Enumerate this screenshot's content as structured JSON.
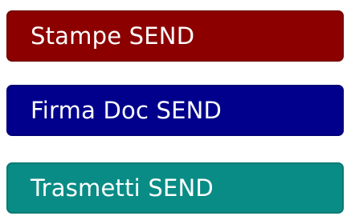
{
  "buttons": [
    {
      "label": "Stampe SEND",
      "color": "#8c0000"
    },
    {
      "label": "Firma Doc SEND",
      "color": "#00008c"
    },
    {
      "label": "Trasmetti SEND",
      "color": "#0a8c86"
    }
  ]
}
